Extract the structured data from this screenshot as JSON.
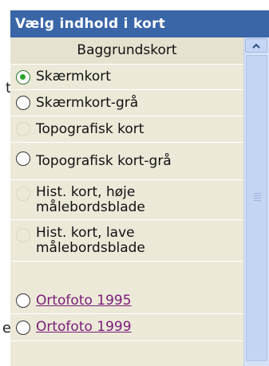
{
  "background_fragments": [
    "t",
    "e"
  ],
  "panel": {
    "title": "Vælg indhold i kort",
    "section_header": "Baggrundskort",
    "items": [
      {
        "label": "Skærmkort",
        "state": "checked"
      },
      {
        "label": "Skærmkort-grå",
        "state": "unchecked"
      },
      {
        "label": "Topografisk kort",
        "state": "disabled"
      },
      {
        "label": "Topografisk kort-grå",
        "state": "unchecked"
      },
      {
        "label": "Hist. kort, høje målebordsblade",
        "state": "disabled"
      },
      {
        "label": "Hist. kort, lave målebordsblade",
        "state": "disabled"
      },
      {
        "label": "Ortofoto 1995",
        "state": "unchecked",
        "link": true
      },
      {
        "label": "Ortofoto 1999",
        "state": "unchecked",
        "link": true
      }
    ]
  },
  "colors": {
    "title_bar": "#3a66a7",
    "list_background": "#ece9d8",
    "link": "#7a1b7a",
    "checked_radio": "#2aa52a",
    "scrollbar": "#d6e2f8"
  },
  "icons": {
    "scroll_up": "chevron-up-icon"
  }
}
